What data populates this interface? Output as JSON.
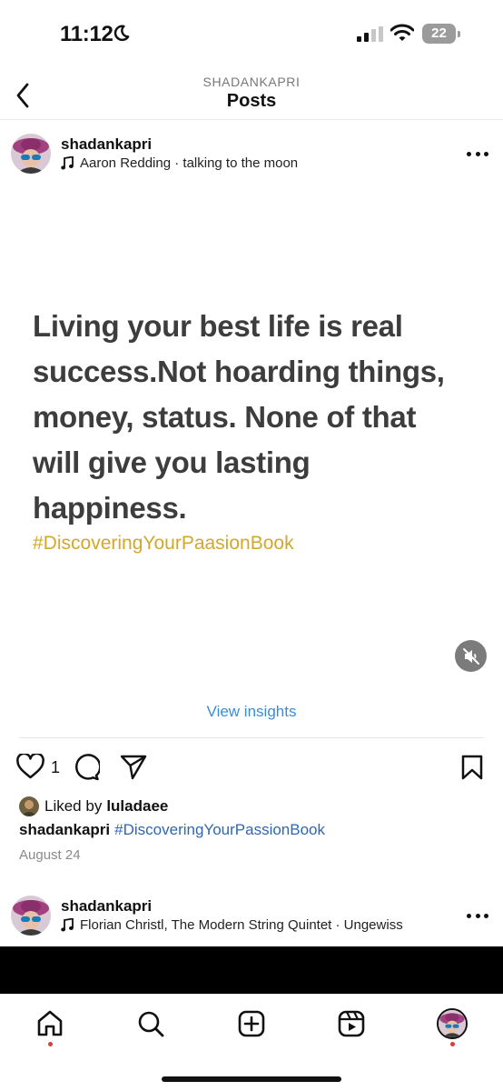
{
  "status_bar": {
    "time": "11:12",
    "battery": "22"
  },
  "header": {
    "account": "SHADANKAPRI",
    "title": "Posts"
  },
  "post": {
    "username": "shadankapri",
    "music": "Aaron Redding · talking to the moon",
    "quote": "Living your best life is real success.Not hoarding things, money, status. None of that will give you lasting happiness.",
    "quote_hashtag": "#DiscoveringYourPaasionBook",
    "view_insights": "View insights",
    "like_count": "1",
    "liked_by_prefix": "Liked by",
    "liked_by_user": "luladaee",
    "caption_user": "shadankapri",
    "caption_text": "#DiscoveringYourPassionBook",
    "date": "August 24"
  },
  "next_post": {
    "username": "shadankapri",
    "music": "Florian Christl, The Modern String Quintet · Ungewiss"
  },
  "nav": {
    "items": [
      "home-icon",
      "search-icon",
      "create-icon",
      "reels-icon",
      "profile-avatar"
    ]
  },
  "colors": {
    "hashtag_gold": "#d2a82b",
    "link_blue": "#3b8cd6",
    "caption_tag_blue": "#2e67b5",
    "quote_text": "#3d3d3d",
    "notification_dot": "#e03a3a"
  }
}
